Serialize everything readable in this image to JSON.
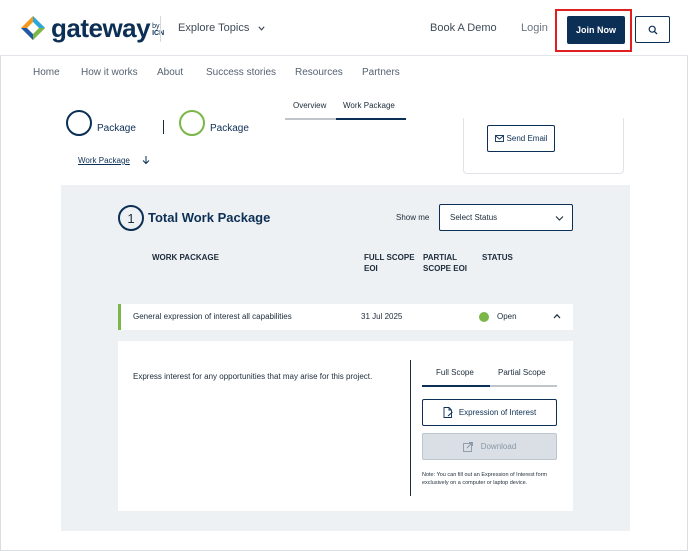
{
  "header": {
    "logo_word": "gateway",
    "logo_by": "by",
    "logo_org": "ICN",
    "explore_label": "Explore Topics",
    "book_demo_label": "Book A Demo",
    "login_label": "Login",
    "join_label": "Join Now",
    "brand_color": "#0c2f55",
    "highlight_color": "#e02020"
  },
  "nav": {
    "items": [
      "Home",
      "How it works",
      "About",
      "Success stories",
      "Resources",
      "Partners"
    ]
  },
  "packages": {
    "first_label": "Package",
    "second_label": "Package",
    "work_package_link": "Work Package"
  },
  "top_tabs": {
    "overview": "Overview",
    "work_package": "Work Package"
  },
  "side_card": {
    "send_email_label": "Send Email"
  },
  "panel": {
    "count": "1",
    "title": "Total Work Package",
    "show_me_label": "Show me",
    "select_value": "Select Status",
    "columns": {
      "work_package": "WORK PACKAGE",
      "full_scope_1": "FULL SCOPE",
      "full_scope_2": "EOI",
      "partial_scope_1": "PARTIAL",
      "partial_scope_2": "SCOPE EOI",
      "status": "STATUS"
    },
    "row": {
      "name": "General expression of interest all capabilities",
      "date": "31 Jul 2025",
      "status": "Open",
      "status_color": "#7ab648"
    },
    "detail": {
      "description": "Express interest for any opportunities that may arise for this project.",
      "tab_full": "Full Scope",
      "tab_partial": "Partial Scope",
      "eoi_label": "Expression of Interest",
      "download_label": "Download",
      "note": "Note: You can fill out an Expression of Interest form exclusively on a computer or laptop device."
    }
  }
}
